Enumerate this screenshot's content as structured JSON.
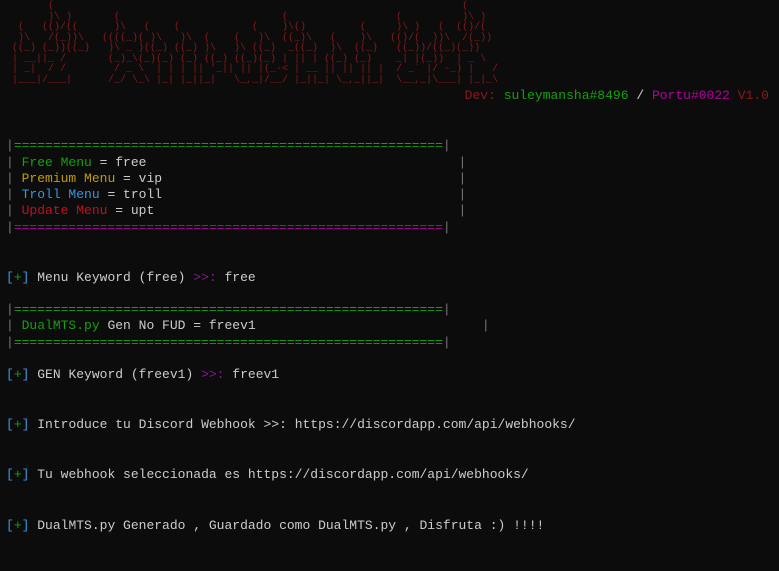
{
  "ascii_banner": "       (                                                                    (\n       )\\ )       (                           (                  (          )\\ )\n  (   (()/((      )\\   (    (            (    )\\()         (     )\\ )   (  (()/(\n  )\\   /(_))\\   ((((_)( )\\   )\\  (    (   )\\  ((_)\\   (    )\\   (()/(  ))\\  /(_))\n ((_) (_))((_)   )\\ _ )((_) ((_) )\\   )\\ ((_)  _((_)  )\\  ((_)   ((_))/((_)(_))\n | __||_ /       (_)_\\(_)(_) (_) ((_) ((_)(_) | || | ((_) (_)    _| |(_))  | _ \\\n | _|  / /        / _ \\  | | | || '_|| || |(_-< | __ || || || |  / _` |/ -_) |   /\n |___|/___|      /_/ \\_\\ |_| |_||_|   \\_,_|/__/ |_||_| \\_,_||_|  \\__,_|\\___| |_|_\\",
  "dev": {
    "label": "Dev:",
    "name1": "suleymansha#8496",
    "sep": "/",
    "name2": "Portu#0022",
    "version": "V1.0"
  },
  "divider_top_pipe": "|",
  "divider_eq": "=======================================================",
  "menu": {
    "free": {
      "label": "Free Menu",
      "eq": " = ",
      "val": "free"
    },
    "premium": {
      "label": "Premium Menu",
      "eq": " = ",
      "val": "vip"
    },
    "troll": {
      "label": "Troll Menu",
      "eq": " = ",
      "val": "troll"
    },
    "update": {
      "label": "Update Menu",
      "eq": " = ",
      "val": "upt"
    }
  },
  "right_pipe_pad": "                                        |",
  "right_pipe_pad2": "                                     |",
  "right_pipe_pad3": "                                       |",
  "right_pipe_pad4": "                                       |",
  "prompts": {
    "lb": "[",
    "plus": "+",
    "rb": "]",
    "menu_kw": " Menu Keyword (free) ",
    "arrow": ">>:",
    "menu_kw_value": " free",
    "gen_kw": " GEN Keyword (freev1) ",
    "gen_kw_value": " freev1",
    "webhook_prompt": " Introduce tu Discord Webhook ",
    "webhook_arrow": ">>:",
    "webhook_value": " https://discordapp.com/api/webhooks/",
    "webhook_selected": " Tu webhook seleccionada es https://discordapp.com/api/webhooks/",
    "generated": " DualMTS.py Generado , Guardado como DualMTS.py , Disfruta :) !!!!"
  },
  "gen_section": {
    "name": "DualMTS.py",
    "label": " Gen No FUD = ",
    "val": "freev1"
  }
}
